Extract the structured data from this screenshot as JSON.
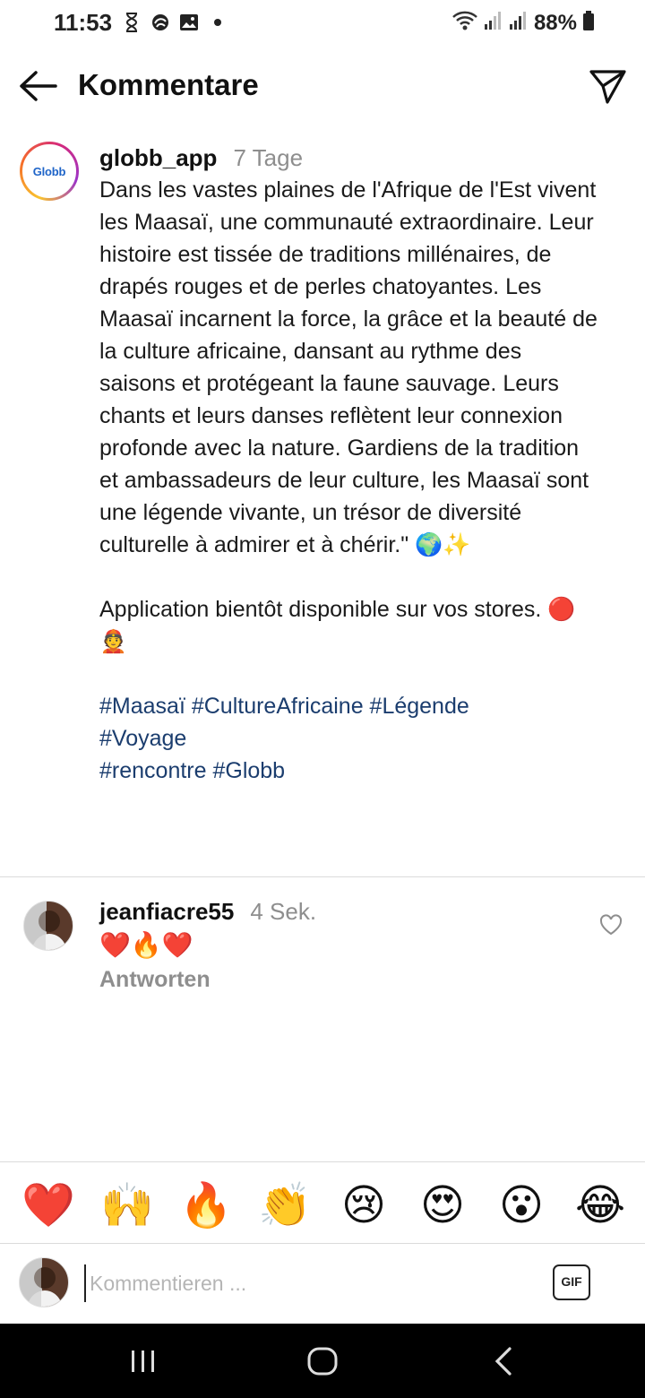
{
  "status_bar": {
    "time": "11:53",
    "battery": "88%"
  },
  "header": {
    "title": "Kommentare"
  },
  "caption": {
    "username": "globb_app",
    "time_ago": "7 Tage",
    "avatar_logo": "Globb",
    "text": "Dans les vastes plaines de l'Afrique de l'Est vivent les Maasaï, une communauté extraordinaire. Leur histoire est tissée de traditions millénaires, de drapés rouges et de perles chatoyantes. Les Maasaï incarnent la force, la grâce et la beauté de la culture africaine, dansant au rythme des saisons et protégeant la faune sauvage. Leurs chants et leurs danses reflètent leur connexion profonde avec la nature. Gardiens de la tradition et ambassadeurs de leur culture, les Maasaï sont une légende vivante, un trésor de diversité culturelle à admirer et à chérir.\" 🌍✨\n\nApplication bientôt disponible sur vos stores. 🔴👲",
    "hashtags_line1": "#Maasaï #CultureAfricaine #Légende",
    "hashtags_line2": "#Voyage",
    "hashtags_line3": "#rencontre #Globb"
  },
  "comment": {
    "username": "jeanfiacre55",
    "time_ago": "4 Sek.",
    "text": "❤️🔥❤️",
    "reply_label": "Antworten"
  },
  "emoji_bar": [
    "❤️",
    "🙌",
    "🔥",
    "👏",
    "😢",
    "😍",
    "😮",
    "😂"
  ],
  "input": {
    "placeholder": "Kommentieren ...",
    "gif_label": "GIF"
  },
  "colors": {
    "hashtag": "#1b3d6e",
    "muted": "#8e8e8e",
    "nav_bg": "#000000"
  }
}
